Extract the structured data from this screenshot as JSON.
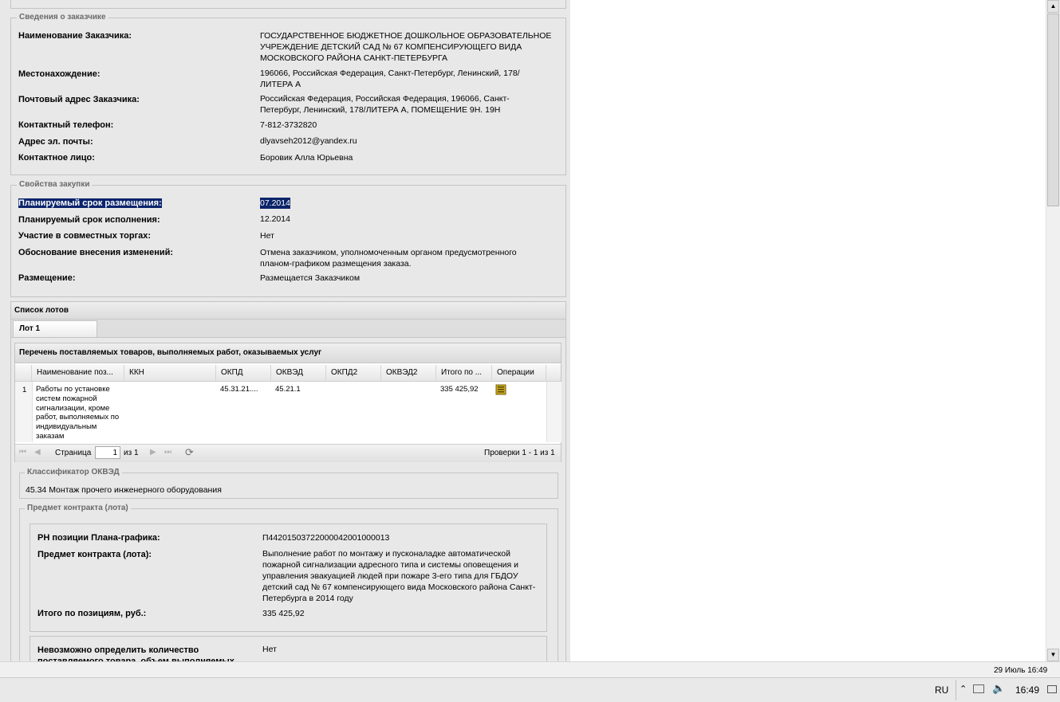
{
  "customer": {
    "legend": "Сведения о заказчике",
    "rows": [
      {
        "label": "Наименование Заказчика:",
        "value": "ГОСУДАРСТВЕННОЕ БЮДЖЕТНОЕ ДОШКОЛЬНОЕ ОБРАЗОВАТЕЛЬНОЕ УЧРЕЖДЕНИЕ ДЕТСКИЙ САД № 67 КОМПЕНСИРУЮЩЕГО ВИДА МОСКОВСКОГО РАЙОНА САНКТ-ПЕТЕРБУРГА"
      },
      {
        "label": "Местонахождение:",
        "value": "196066, Российская Федерация, Санкт-Петербург, Ленинский, 178/ЛИТЕРА А"
      },
      {
        "label": "Почтовый адрес Заказчика:",
        "value": "Российская Федерация, Российская Федерация, 196066, Санкт-Петербург, Ленинский, 178/ЛИТЕРА А, ПОМЕЩЕНИЕ 9Н. 19Н"
      },
      {
        "label": "Контактный телефон:",
        "value": "7-812-3732820"
      },
      {
        "label": "Адрес эл. почты:",
        "value": "dlyavseh2012@yandex.ru"
      },
      {
        "label": "Контактное лицо:",
        "value": "Боровик Алла Юрьевна"
      }
    ]
  },
  "purchase": {
    "legend": "Свойства закупки",
    "rows": [
      {
        "label": "Планируемый срок размещения:",
        "value": "07.2014"
      },
      {
        "label": "Планируемый срок исполнения:",
        "value": "12.2014"
      },
      {
        "label": "Участие в совместных торгах:",
        "value": "Нет"
      },
      {
        "label": "Обоснование внесения изменений:",
        "value": "Отмена заказчиком, уполномоченным органом предусмотренного планом-графиком размещения заказа."
      },
      {
        "label": "Размещение:",
        "value": "Размещается Заказчиком"
      }
    ]
  },
  "lots": {
    "title": "Список лотов",
    "tab": "Лот 1",
    "grid_title": "Перечень поставляемых товаров, выполняемых работ, оказываемых услуг",
    "columns": [
      "Наименование поз...",
      "ККН",
      "ОКПД",
      "ОКВЭД",
      "ОКПД2",
      "ОКВЭД2",
      "Итого по ...",
      "Операции"
    ],
    "row": {
      "num": "1",
      "name": "Работы по установке систем пожарной сигнализации, кроме работ, выполняемых по индивидуальным заказам",
      "kkn": "",
      "okpd": "45.31.21....",
      "okved": "45.21.1",
      "okpd2": "",
      "okved2": "",
      "total": "335 425,92"
    },
    "pager": {
      "page_label": "Страница",
      "page_value": "1",
      "of_label": "из 1",
      "status": "Проверки 1 - 1 из 1"
    }
  },
  "okved": {
    "legend": "Классификатор ОКВЭД",
    "value": "45.34 Монтаж прочего инженерного оборудования"
  },
  "contract": {
    "legend": "Предмет контракта (лота)",
    "rows": [
      {
        "label": "РН позиции Плана-графика:",
        "value": "П44201503722000042001000013"
      },
      {
        "label": "Предмет контракта (лота):",
        "value": "Выполнение работ по монтажу и пусконаладке автоматической пожарной сигнализации адресного типа и системы оповещения и управления эвакуацией людей при пожаре 3-его типа для ГБДОУ детский сад № 67 компенсирующего вида Московского района Санкт-Петербурга в 2014 году"
      },
      {
        "label": "Итого по позициям, руб.:",
        "value": "335 425,92"
      }
    ],
    "bottom": {
      "label": "Невозможно определить количество поставляемого товара, объем выполняемых",
      "value": "Нет"
    }
  },
  "statusbar": {
    "datetime": "29 Июль 16:49"
  },
  "taskbar": {
    "lang": "RU",
    "time": "16:49"
  }
}
